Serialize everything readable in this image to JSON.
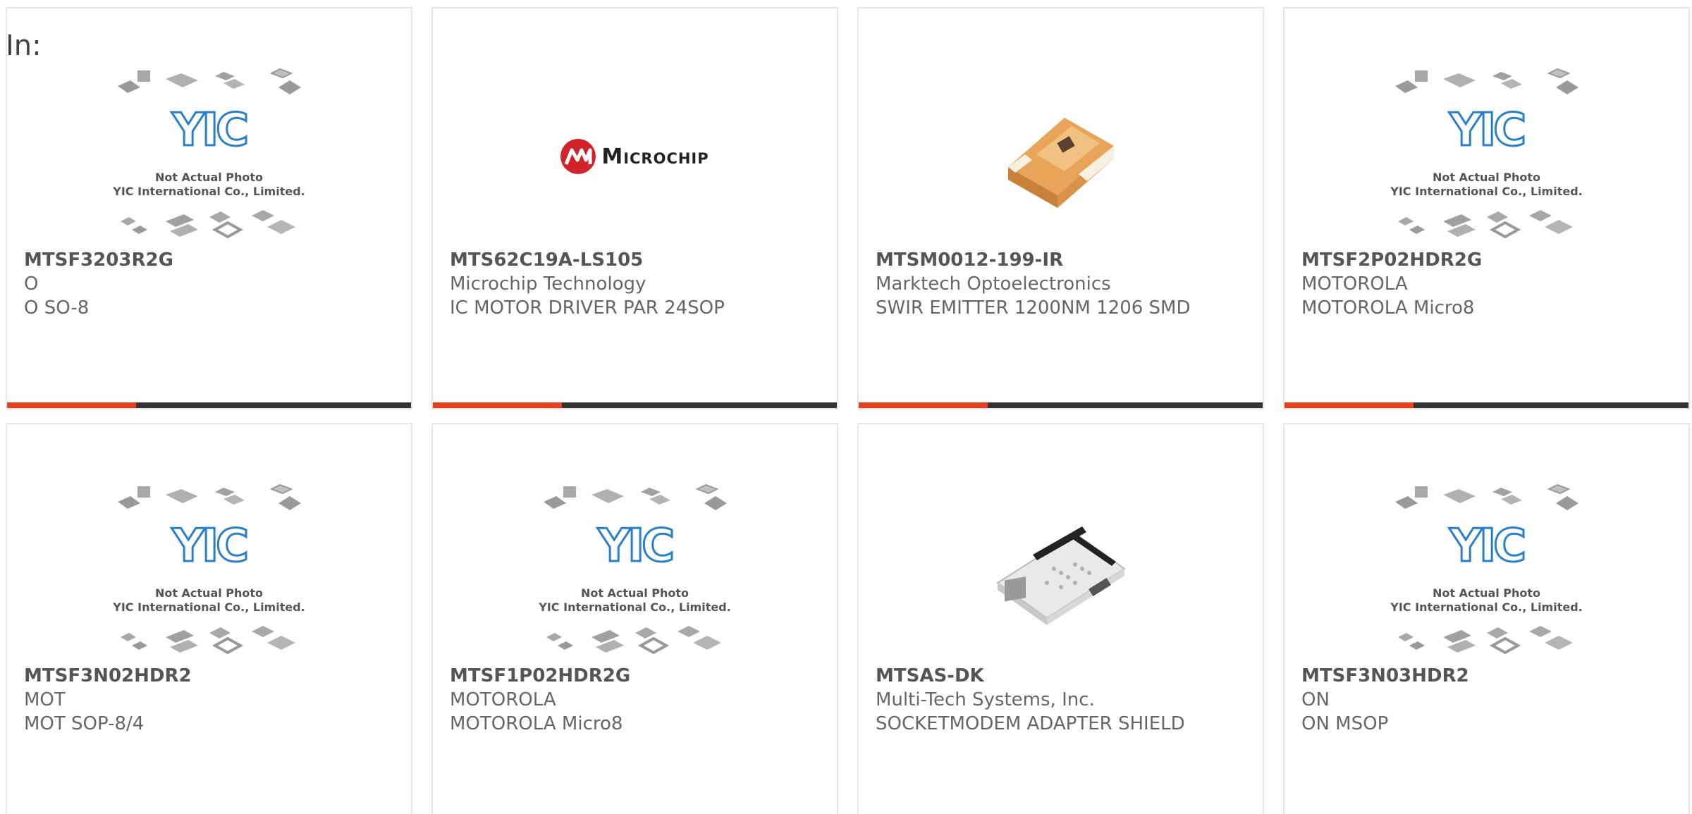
{
  "page": {
    "in_label": "In:"
  },
  "placeholder": {
    "note_line1": "Not Actual Photo",
    "note_line2": "YIC International Co., Limited.",
    "logo_text": "YIC"
  },
  "microchip_logo_text": "Microchip",
  "colors": {
    "accent": "#e8401c",
    "bar": "#333333",
    "border": "#e6e6e6",
    "yic_blue": "#2a7fc9",
    "microchip_red": "#d2232a"
  },
  "products": [
    {
      "part_number": "MTSF3203R2G",
      "manufacturer": "O",
      "description": "O SO-8",
      "image": "yic-placeholder"
    },
    {
      "part_number": "MTS62C19A-LS105",
      "manufacturer": "Microchip Technology",
      "description": "IC MOTOR DRIVER PAR 24SOP",
      "image": "microchip-logo"
    },
    {
      "part_number": "MTSM0012-199-IR",
      "manufacturer": "Marktech Optoelectronics",
      "description": "SWIR EMITTER 1200NM 1206 SMD",
      "image": "led-photo"
    },
    {
      "part_number": "MTSF2P02HDR2G",
      "manufacturer": "MOTOROLA",
      "description": "MOTOROLA Micro8",
      "image": "yic-placeholder"
    },
    {
      "part_number": "MTSF3N02HDR2",
      "manufacturer": "MOT",
      "description": "MOT SOP-8/4",
      "image": "yic-placeholder"
    },
    {
      "part_number": "MTSF1P02HDR2G",
      "manufacturer": "MOTOROLA",
      "description": "MOTOROLA Micro8",
      "image": "yic-placeholder"
    },
    {
      "part_number": "MTSAS-DK",
      "manufacturer": "Multi-Tech Systems, Inc.",
      "description": "SOCKETMODEM ADAPTER SHIELD",
      "image": "board-photo"
    },
    {
      "part_number": "MTSF3N03HDR2",
      "manufacturer": "ON",
      "description": "ON MSOP",
      "image": "yic-placeholder"
    }
  ]
}
